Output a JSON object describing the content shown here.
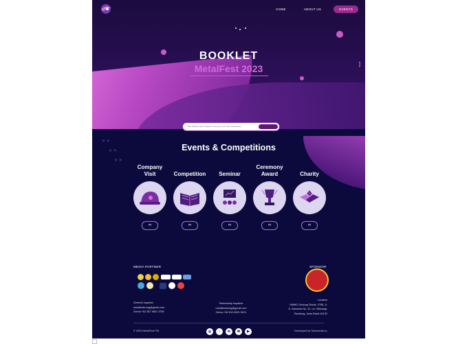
{
  "nav": {
    "home": "HOME",
    "about": "ABOUT US",
    "events": "EVENTS"
  },
  "hero": {
    "title": "BOOKLET",
    "subtitle": "MetalFest 2023",
    "side_text": "Scroll"
  },
  "cookie": {
    "text": "This website uses cookies to improve your web experience."
  },
  "events_section": {
    "title": "Events & Competitions",
    "items": [
      {
        "label": "Company Visit",
        "button": "∞"
      },
      {
        "label": "Competition",
        "button": "∞"
      },
      {
        "label": "Seminar",
        "button": "∞"
      },
      {
        "label": "Ceremony Award",
        "button": "∞"
      },
      {
        "label": "Charity",
        "button": "∞"
      }
    ]
  },
  "footer": {
    "media_partner_label": "MEDIA PARTNER",
    "sponsor_label": "SPONSOR",
    "general_inquiries": {
      "title": "General Inquiries",
      "email": "metalfestmmg@gmail.com",
      "phone": "Zerina +62 857 9821 3765"
    },
    "partnership": {
      "title": "Partnership Inquiries",
      "email": "metalfestmmg@gmail.com",
      "phone": "Zerina +62 812 8521 5021"
    },
    "location": {
      "title": "Location",
      "line1": "HMMG Gedung Teknik, ITSB, Jl.",
      "line2": "Jl. Ganesha No. 10, Lb. Siliwangi,",
      "line3": "Bandung, Jawa Barat 40132"
    },
    "copyright": "© 2023 MetalFest ITB",
    "developed": "Developed by Tokomedia.co",
    "colors": {
      "accent": "#9b2a8e",
      "pink": "#d569e0",
      "bg": "#0c0a3d"
    }
  }
}
